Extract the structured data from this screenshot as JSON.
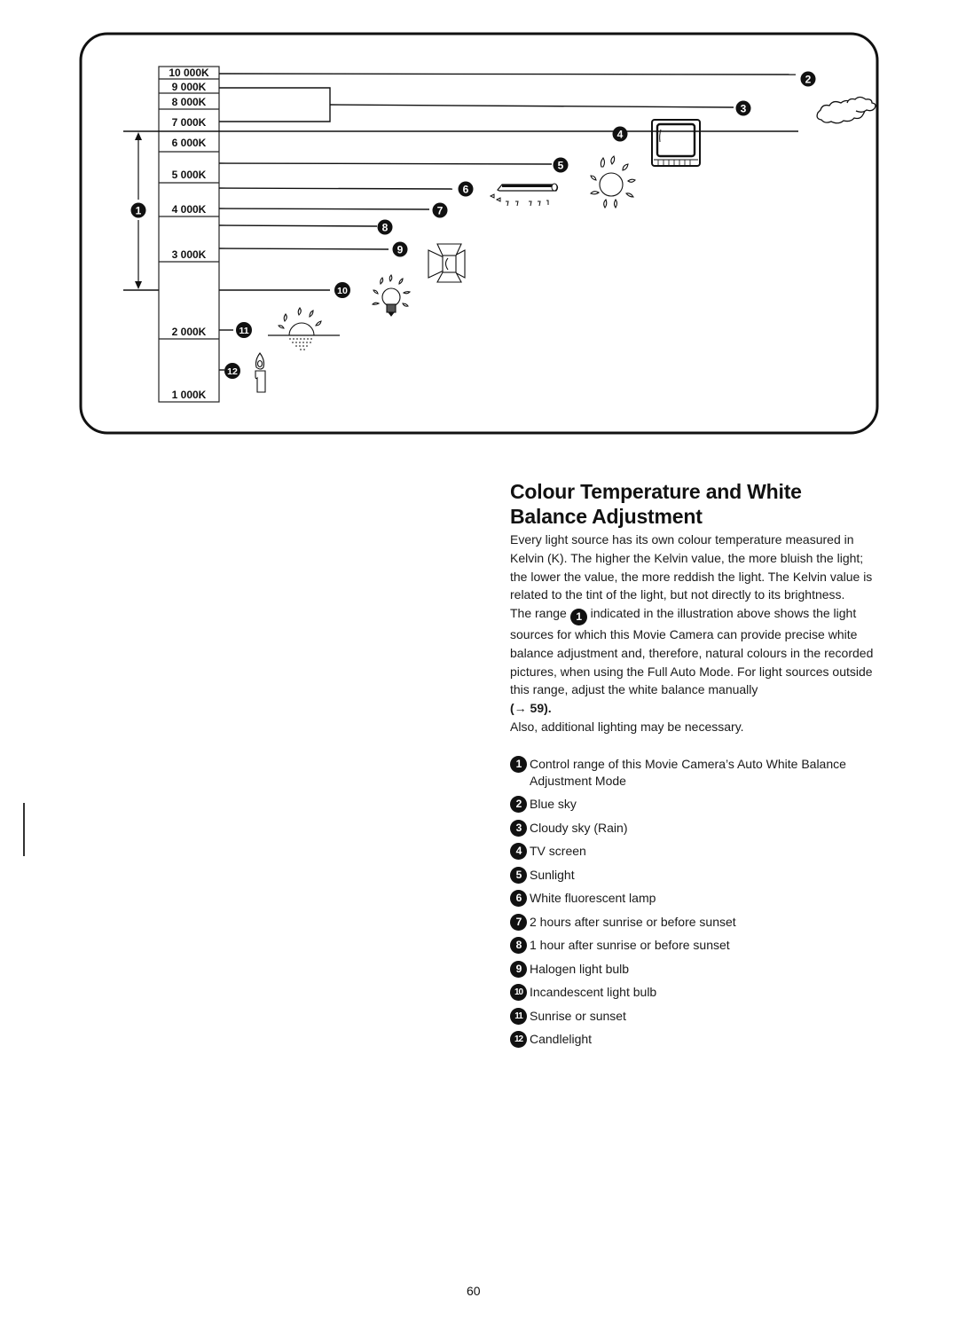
{
  "diagram": {
    "scale_labels": [
      "10 000K",
      "9 000K",
      "8 000K",
      "7 000K",
      "6 000K",
      "5 000K",
      "4 000K",
      "3 000K",
      "2 000K",
      "1 000K"
    ],
    "range_marker": "1",
    "markers": [
      {
        "num": "2",
        "icon": "blue-sky"
      },
      {
        "num": "3",
        "icon": "cloud-icon"
      },
      {
        "num": "4",
        "icon": "tv-icon"
      },
      {
        "num": "5",
        "icon": "sun-icon"
      },
      {
        "num": "6",
        "icon": "fluorescent-lamp-icon"
      },
      {
        "num": "7",
        "icon": ""
      },
      {
        "num": "8",
        "icon": ""
      },
      {
        "num": "9",
        "icon": "halogen-lamp-icon"
      },
      {
        "num": "10",
        "icon": "light-bulb-icon"
      },
      {
        "num": "11",
        "icon": "sunset-icon"
      },
      {
        "num": "12",
        "icon": "candle-icon"
      }
    ]
  },
  "section": {
    "title_line1": "Colour Temperature and White",
    "title_line2": "Balance Adjustment",
    "para1": "Every light source has its own colour temperature measured in Kelvin (K). The higher the Kelvin value, the more bluish the light; the lower the value, the more reddish the light. The Kelvin value is related to the tint of the light, but not directly to its brightness.",
    "para2_before": "The range",
    "para2_badge": "1",
    "para2_after": "indicated in the illustration above shows the light sources for which this Movie Camera can provide precise white balance adjustment and, therefore, natural colours in the recorded pictures, when using the Full Auto Mode. For light sources outside this range, adjust the white balance manually",
    "para2_ref": "(→ 59).",
    "para3": "Also, additional lighting may be necessary."
  },
  "legend": [
    {
      "num": "1",
      "text": "Control range of this Movie Camera’s Auto White Balance Adjustment Mode"
    },
    {
      "num": "2",
      "text": "Blue sky"
    },
    {
      "num": "3",
      "text": "Cloudy sky (Rain)"
    },
    {
      "num": "4",
      "text": "TV screen"
    },
    {
      "num": "5",
      "text": "Sunlight"
    },
    {
      "num": "6",
      "text": "White fluorescent lamp"
    },
    {
      "num": "7",
      "text": "2 hours after sunrise or before sunset"
    },
    {
      "num": "8",
      "text": "1 hour after sunrise or before sunset"
    },
    {
      "num": "9",
      "text": "Halogen light bulb"
    },
    {
      "num": "10",
      "text": "Incandescent light bulb"
    },
    {
      "num": "11",
      "text": "Sunrise or sunset"
    },
    {
      "num": "12",
      "text": "Candlelight"
    }
  ],
  "page_number": "60"
}
